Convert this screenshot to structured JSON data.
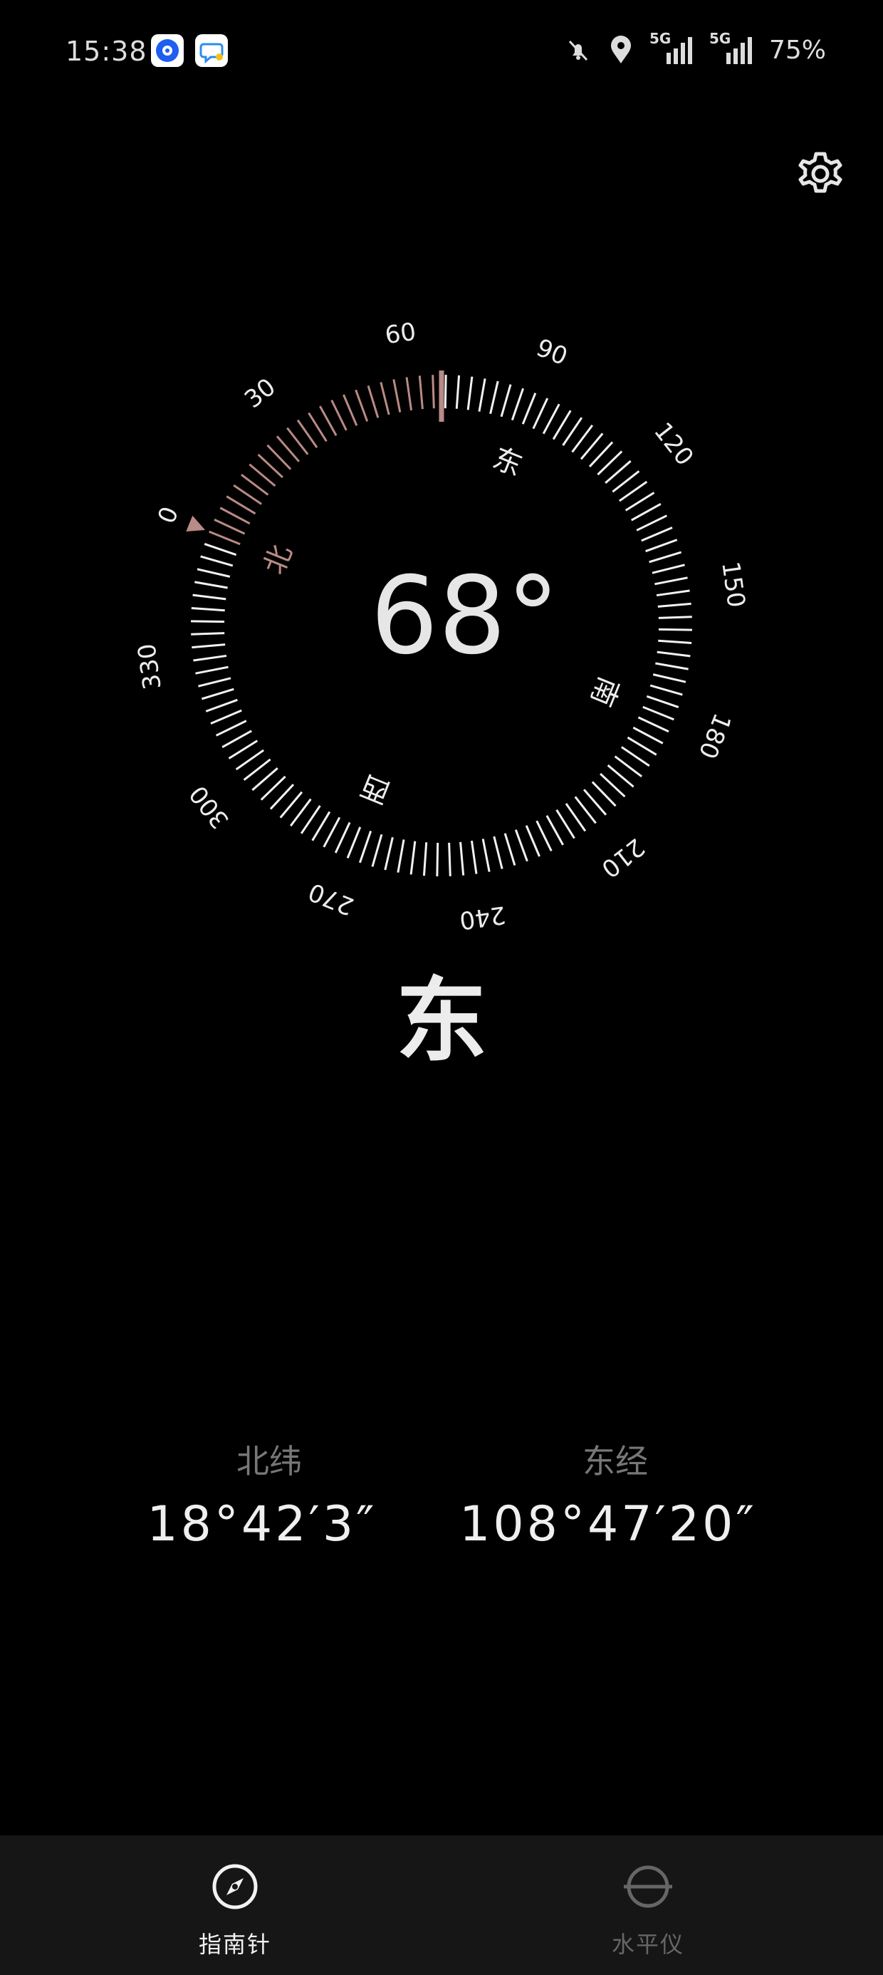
{
  "status_bar": {
    "time": "15:38",
    "network_1": "5G",
    "network_2": "5G",
    "battery": "75%",
    "icons": [
      "app-icon-1",
      "app-icon-2",
      "bell-off-icon",
      "location-pin-icon",
      "signal-icon",
      "signal-icon"
    ]
  },
  "settings": {
    "icon": "gear-icon"
  },
  "compass": {
    "heading_deg": 68,
    "heading_text": "68°",
    "direction": "东",
    "dial_labels": [
      "0",
      "30",
      "60",
      "90",
      "120",
      "150",
      "180",
      "210",
      "240",
      "270",
      "300",
      "330"
    ],
    "cardinals": {
      "north": "北",
      "east": "东",
      "south": "南",
      "west": "西"
    },
    "accent_color": "#b98b86",
    "tick_color": "#f2f2f2"
  },
  "coordinates": {
    "latitude_label": "北纬",
    "latitude_value": "18°42′3″",
    "longitude_label": "东经",
    "longitude_value": "108°47′20″"
  },
  "bottom_nav": {
    "items": [
      {
        "label": "指南针",
        "icon": "compass-icon",
        "active": true
      },
      {
        "label": "水平仪",
        "icon": "level-icon",
        "active": false
      }
    ]
  }
}
